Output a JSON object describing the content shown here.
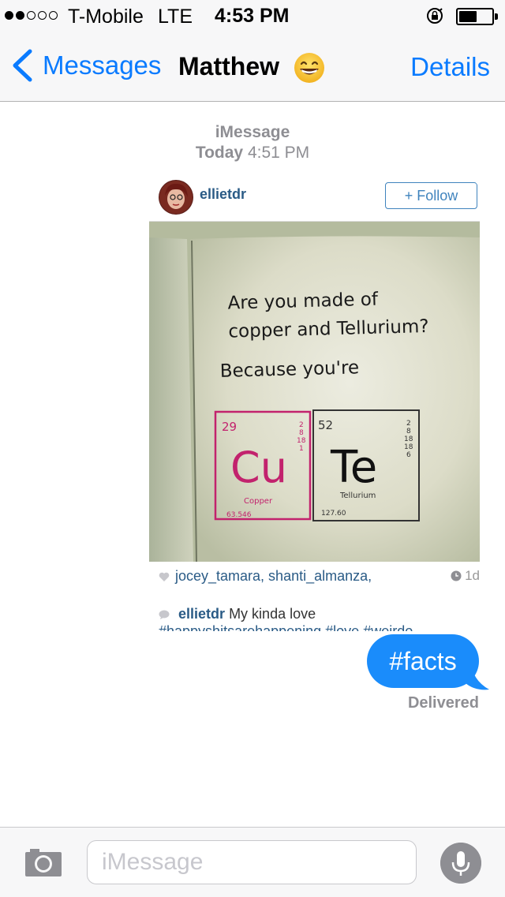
{
  "status_bar": {
    "carrier": "T-Mobile",
    "network": "LTE",
    "time": "4:53 PM",
    "signal_bars": 2,
    "signal_total": 5
  },
  "nav": {
    "back_label": "Messages",
    "title": "Matthew",
    "emoji": "grinning-face-emoji",
    "details_label": "Details"
  },
  "thread": {
    "service": "iMessage",
    "date_day": "Today",
    "date_time": "4:51 PM"
  },
  "instagram_card": {
    "username": "ellietdr",
    "follow_label": "+ Follow",
    "photo_text": {
      "line1": "Are you made of",
      "line2": "copper and Tellurium?",
      "line3": "Because you're",
      "cu_number": "29",
      "cu_symbol": "Cu",
      "cu_name": "Copper",
      "cu_mass": "63.546",
      "cu_shells": [
        "2",
        "8",
        "18",
        "1"
      ],
      "te_number": "52",
      "te_symbol": "Te",
      "te_name": "Tellurium",
      "te_mass": "127.60",
      "te_shells": [
        "2",
        "8",
        "18",
        "18",
        "6"
      ]
    },
    "likes_users": "jocey_tamara, shanti_almanza,",
    "time_ago": "1d",
    "caption_user": "ellietdr",
    "caption_text": "My kinda love",
    "caption_hashtags": "#happyshitsarehappening #love #weirdo"
  },
  "sent_message": {
    "text": "#facts",
    "status": "Delivered"
  },
  "input_bar": {
    "placeholder": "iMessage"
  },
  "colors": {
    "ios_blue": "#0a7bff",
    "bubble_blue": "#1a8cfb",
    "instagram_link": "#2a5b86",
    "gray_text": "#8e8e93"
  }
}
